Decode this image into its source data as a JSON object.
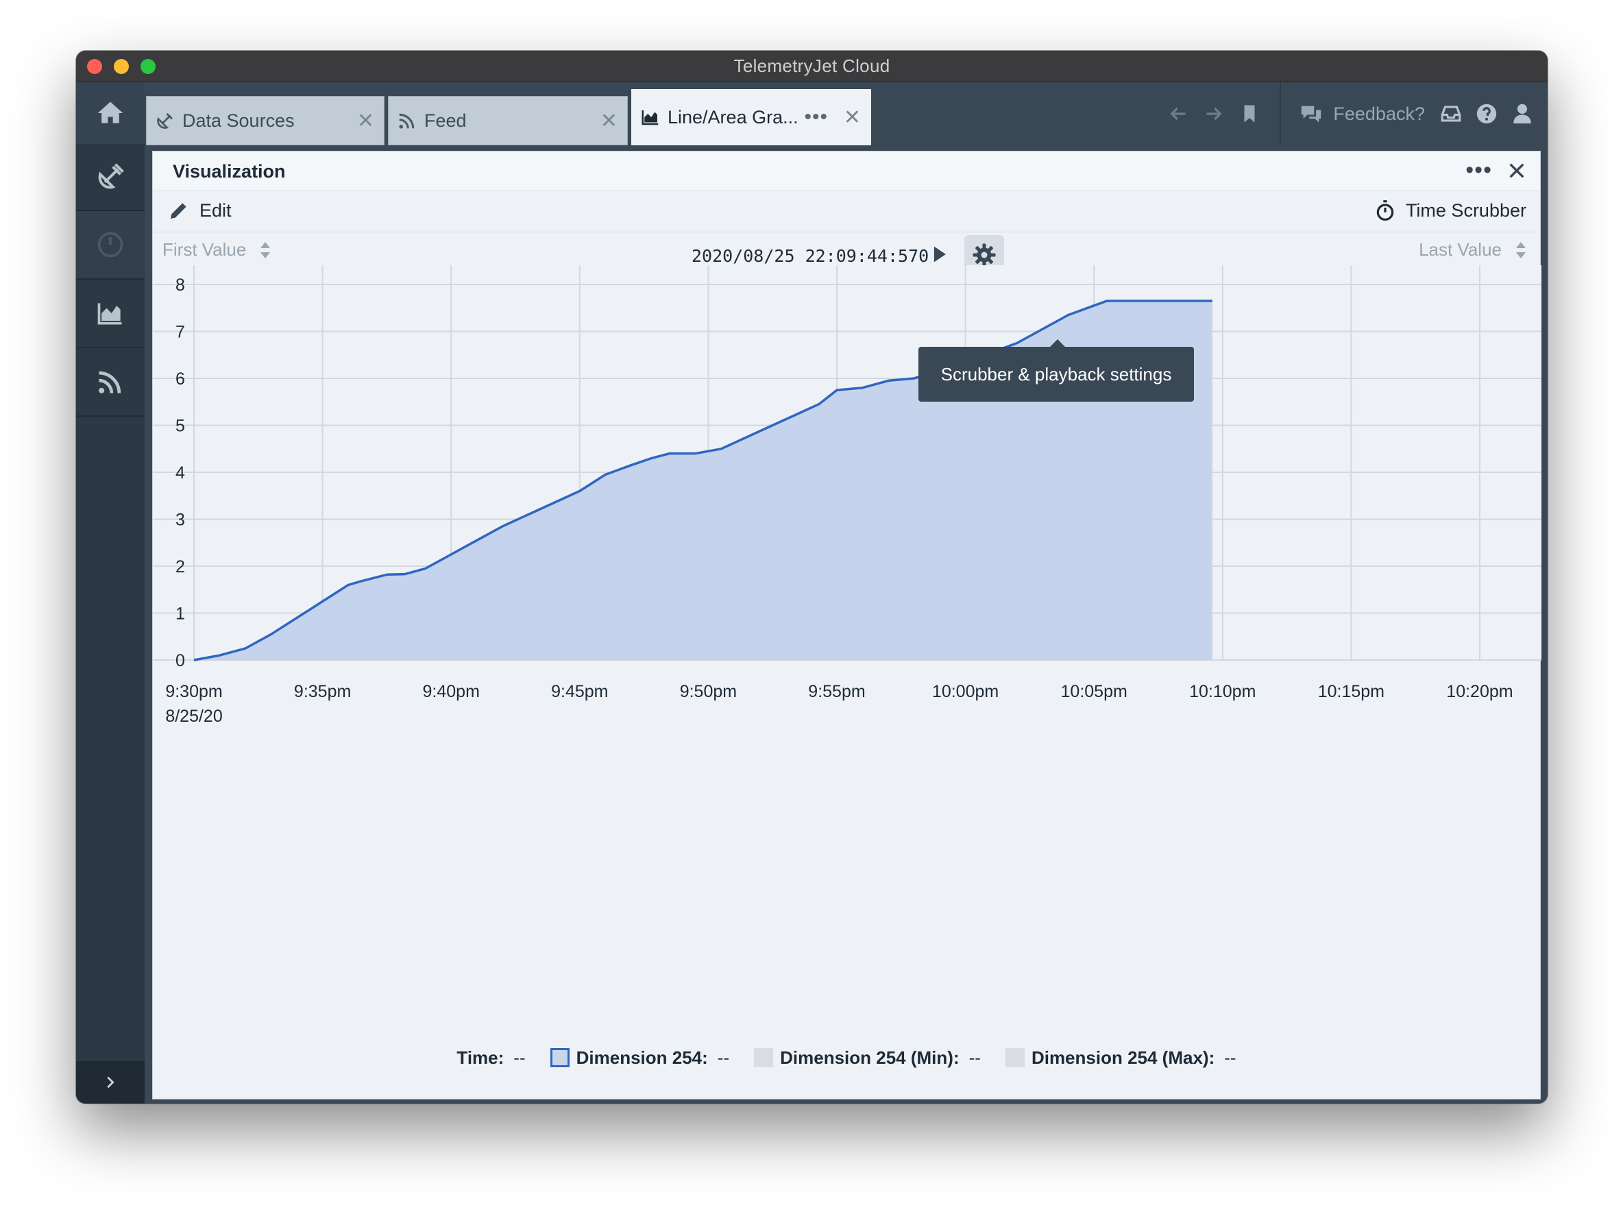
{
  "window": {
    "title": "TelemetryJet Cloud"
  },
  "tabs": [
    {
      "label": "Data Sources",
      "icon": "satellite-dish-icon"
    },
    {
      "label": "Feed",
      "icon": "rss-icon"
    },
    {
      "label": "Line/Area Gra...",
      "icon": "area-chart-icon",
      "active": true
    }
  ],
  "topbar": {
    "feedback_label": "Feedback?"
  },
  "panel": {
    "title": "Visualization",
    "edit_label": "Edit",
    "time_scrubber_label": "Time Scrubber"
  },
  "scrubber": {
    "first_value_label": "First Value",
    "last_value_label": "Last Value",
    "timestamp": "2020/08/25 22:09:44:570",
    "tooltip": "Scrubber & playback settings",
    "position_fraction": 0.766
  },
  "colors": {
    "line": "#2f66c2",
    "area": "#c5d4ec",
    "accent": "#3f8fd0",
    "chrome": "#3a4754"
  },
  "chart_data": {
    "type": "area",
    "series": [
      {
        "name": "Dimension 254",
        "points": [
          [
            0.0,
            0.0
          ],
          [
            1.0,
            0.1
          ],
          [
            2.0,
            0.25
          ],
          [
            3.0,
            0.55
          ],
          [
            4.0,
            0.9
          ],
          [
            5.0,
            1.25
          ],
          [
            6.0,
            1.6
          ],
          [
            6.5,
            1.68
          ],
          [
            7.5,
            1.82
          ],
          [
            8.2,
            1.83
          ],
          [
            9.0,
            1.95
          ],
          [
            10.0,
            2.25
          ],
          [
            11.0,
            2.55
          ],
          [
            12.0,
            2.85
          ],
          [
            13.0,
            3.1
          ],
          [
            14.0,
            3.35
          ],
          [
            15.0,
            3.6
          ],
          [
            16.0,
            3.95
          ],
          [
            17.0,
            4.15
          ],
          [
            17.8,
            4.3
          ],
          [
            18.5,
            4.4
          ],
          [
            19.5,
            4.4
          ],
          [
            20.5,
            4.5
          ],
          [
            21.5,
            4.75
          ],
          [
            22.5,
            5.0
          ],
          [
            23.5,
            5.25
          ],
          [
            24.3,
            5.45
          ],
          [
            25.0,
            5.75
          ],
          [
            26.0,
            5.8
          ],
          [
            27.0,
            5.95
          ],
          [
            28.0,
            6.0
          ],
          [
            29.0,
            6.15
          ],
          [
            30.0,
            6.35
          ],
          [
            31.0,
            6.55
          ],
          [
            32.0,
            6.75
          ],
          [
            33.0,
            7.05
          ],
          [
            34.0,
            7.35
          ],
          [
            35.0,
            7.55
          ],
          [
            35.5,
            7.65
          ],
          [
            39.6,
            7.65
          ]
        ]
      }
    ],
    "x_tick_labels": [
      "9:30pm",
      "9:35pm",
      "9:40pm",
      "9:45pm",
      "9:50pm",
      "9:55pm",
      "10:00pm",
      "10:05pm",
      "10:10pm",
      "10:15pm",
      "10:20pm"
    ],
    "x_date_label": "8/25/20",
    "y_ticks": [
      0,
      1,
      2,
      3,
      4,
      5,
      6,
      7,
      8
    ],
    "xlim_minutes": [
      -1.6,
      52.4
    ],
    "ylim": [
      0,
      8
    ],
    "grid": true
  },
  "legend": {
    "time_label": "Time:",
    "time_value": "--",
    "items": [
      {
        "label": "Dimension 254:",
        "value": "--"
      },
      {
        "label": "Dimension 254 (Min):",
        "value": "--"
      },
      {
        "label": "Dimension 254 (Max):",
        "value": "--"
      }
    ]
  }
}
